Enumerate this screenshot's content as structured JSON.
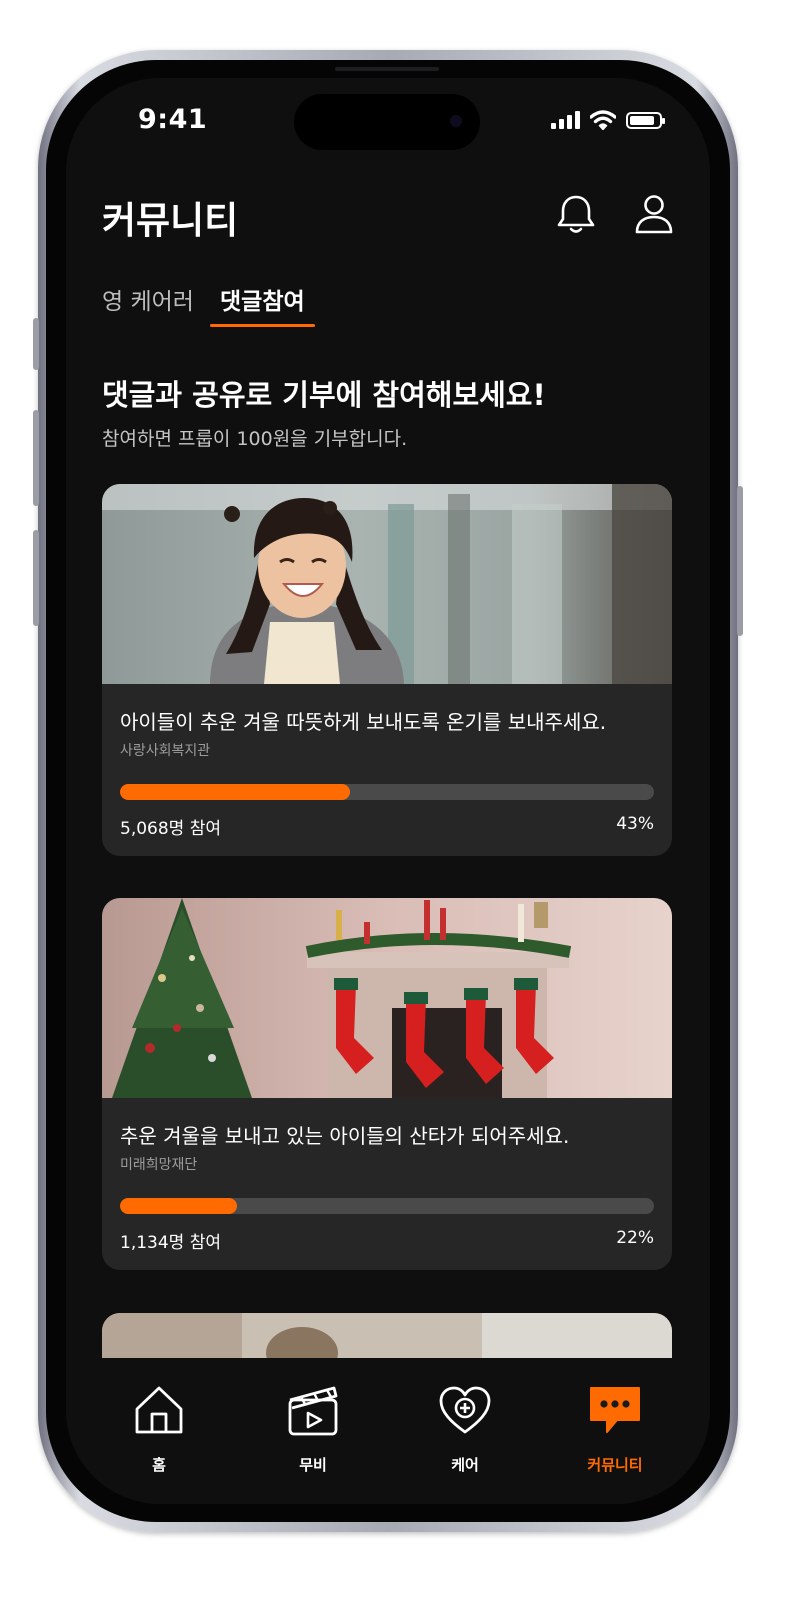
{
  "status_bar": {
    "time": "9:41"
  },
  "header": {
    "title": "커뮤니티",
    "bell_icon": "bell-icon",
    "profile_icon": "user-icon"
  },
  "tabs": [
    {
      "label": "영 케어러",
      "active": false
    },
    {
      "label": "댓글참여",
      "active": true
    }
  ],
  "intro": {
    "headline": "댓글과 공유로 기부에 참여해보세요!",
    "subtitle": "참여하면 프룹이 100원을 기부합니다."
  },
  "cards": [
    {
      "title": "아이들이 추운 겨울 따뜻하게 보내도록 온기를 보내주세요.",
      "organization": "사랑사회복지관",
      "participants": "5,068명 참여",
      "percent_label": "43%",
      "progress": 0.43,
      "image": "smiling-child-photo"
    },
    {
      "title": "추운 겨울을 보내고 있는 아이들의 산타가 되어주세요.",
      "organization": "미래희망재단",
      "participants": "1,134명 참여",
      "percent_label": "22%",
      "progress": 0.22,
      "image": "christmas-fireplace-photo"
    }
  ],
  "bottom_nav": [
    {
      "label": "홈",
      "icon": "home-icon",
      "active": false
    },
    {
      "label": "무비",
      "icon": "clapperboard-icon",
      "active": false
    },
    {
      "label": "케어",
      "icon": "heart-plus-icon",
      "active": false
    },
    {
      "label": "커뮤니티",
      "icon": "chat-bubble-icon",
      "active": true
    }
  ],
  "colors": {
    "accent": "#ff6b00",
    "background": "#0f0f0f",
    "card": "#262626",
    "track": "#4a4a4a"
  }
}
